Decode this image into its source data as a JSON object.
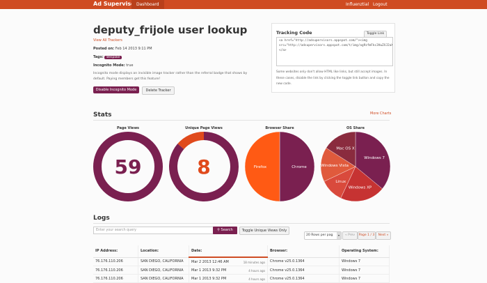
{
  "nav": {
    "brand": "Ad Supervisors",
    "dashboard": "Dashboard",
    "user": "Influenztial",
    "logout": "Logout"
  },
  "page": {
    "title": "deputy_frijole user lookup",
    "view_all": "View All Trackers",
    "posted_label": "Posted on:",
    "posted_value": "Feb 14 2013 9:11 PM",
    "tags_label": "Tags:",
    "tag": "Bespoke",
    "incognito_label": "Incognito Mode:",
    "incognito_value": "true",
    "incognito_desc": "Incognito mode displays an invisible image tracker rather than the referral badge that shows by default. Paying members get this feature!",
    "disable_btn": "Disable Incognito Mode",
    "delete_btn": "Delete Tracker"
  },
  "tracking": {
    "title": "Tracking Code",
    "toggle_link": "Toggle Link",
    "code": "<a href=\"http://adsupervisors.appspot.com/\"><img src=\"http://adsupervisors.appspot.com/t/img/ag9zfmFkc3VwZXJ2aXNvcnNyNQsSDFVzZXJuIcmFjaZVycyIVVITEyNzUvbIztUiHJjH4NTg3NTc4Ekg4DAo5B1RyYWNrZXIY4101.png\"></a>",
    "note": "Some websites only don't allow HTML like links, but still accept images. In these cases, disable the link by clicking the toggle link button and copy the new code."
  },
  "stats": {
    "heading": "Stats",
    "more_charts": "More Charts"
  },
  "chart_data": [
    {
      "type": "donut",
      "title": "Page Views",
      "center_label": "59",
      "values": [
        59
      ],
      "colors": [
        "#7a2050"
      ]
    },
    {
      "type": "donut",
      "title": "Unique Page Views",
      "center_label": "8",
      "categories": [
        "Unique",
        "Other"
      ],
      "values": [
        8,
        51
      ],
      "colors": [
        "#e04a1c",
        "#7a2050"
      ]
    },
    {
      "type": "pie",
      "title": "Browser Share",
      "categories": [
        "Chrome",
        "Firefox"
      ],
      "values": [
        50,
        50
      ],
      "colors": [
        "#7a2050",
        "#ff5a14"
      ]
    },
    {
      "type": "pie",
      "title": "OS Share",
      "categories": [
        "Windows 7",
        "Windows XP",
        "Linux",
        "Windows Vista",
        "Mac OS X"
      ],
      "values": [
        36,
        21,
        11,
        16,
        16
      ],
      "colors": [
        "#7a2050",
        "#c63332",
        "#d94a3c",
        "#e05a3c",
        "#8a2b3e"
      ]
    }
  ],
  "logs": {
    "heading": "Logs",
    "search_placeholder": "Enter your search query",
    "search_btn": "Search",
    "toggle_unique": "Toggle Unique Views Only",
    "rows_per_page": "20 Rows per pag",
    "prev": "« Prev",
    "page_info": "Page 1 / 3",
    "next": "Next »",
    "columns": [
      "IP Address:",
      "Location:",
      "Date:",
      "Browser:",
      "Operating System:"
    ],
    "rows": [
      {
        "ip": "76.176.110.206",
        "location": "SAN DIEGO, CALIFORNIA",
        "date": "Mar 2 2013 12:46 AM",
        "ago": "18 minutes ago",
        "browser": "Chrome v25.0.1364",
        "os": "Windows 7"
      },
      {
        "ip": "76.176.110.206",
        "location": "SAN DIEGO, CALIFORNIA",
        "date": "Mar 1 2013 9:32 PM",
        "ago": "4 hours ago",
        "browser": "Chrome v25.0.1364",
        "os": "Windows 7"
      },
      {
        "ip": "76.176.110.206",
        "location": "SAN DIEGO, CALIFORNIA",
        "date": "Mar 1 2013 9:32 PM",
        "ago": "4 hours ago",
        "browser": "Chrome v25.0.1364",
        "os": "Windows 7"
      }
    ]
  }
}
